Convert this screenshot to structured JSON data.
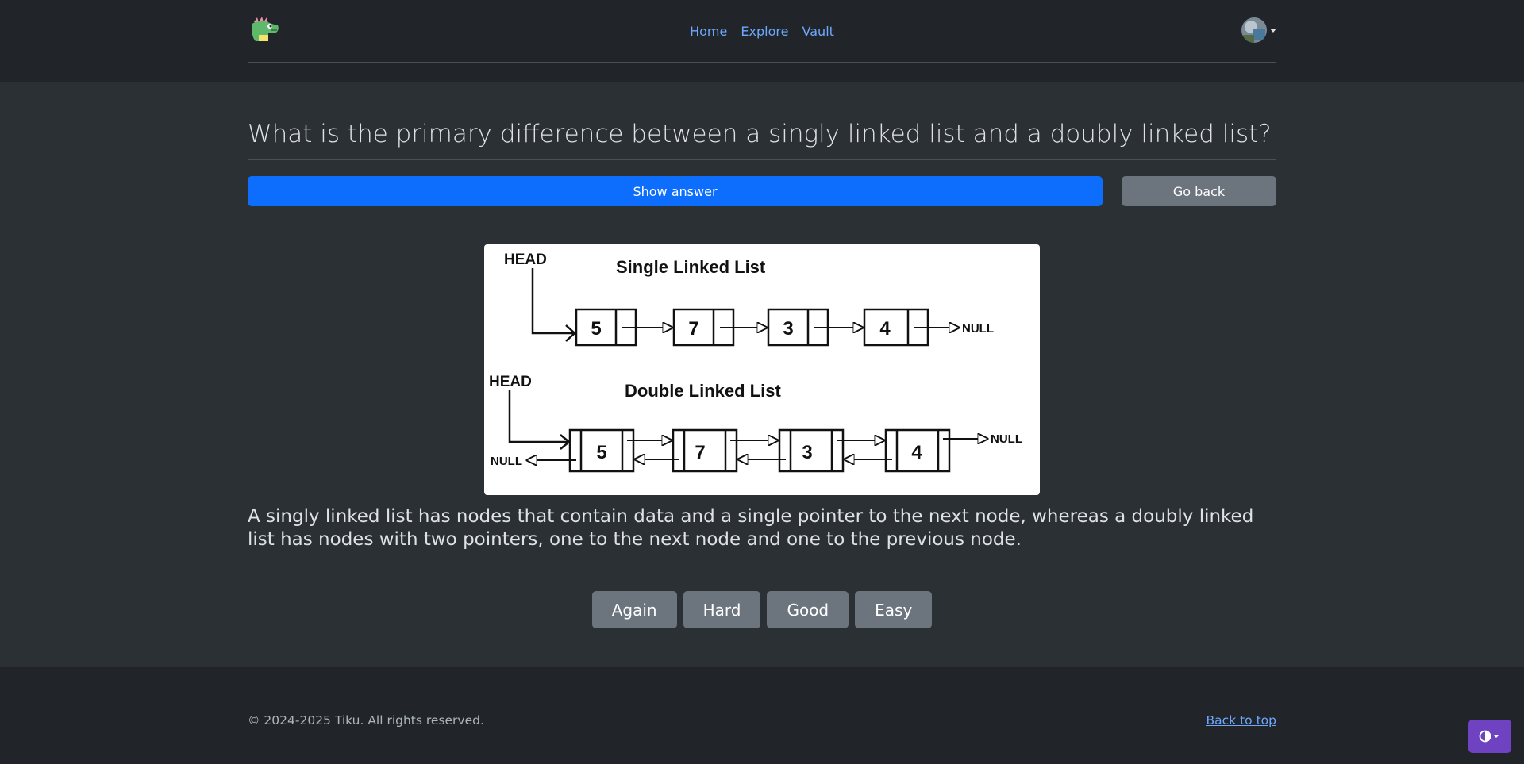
{
  "nav": {
    "items": [
      {
        "label": "Home"
      },
      {
        "label": "Explore"
      },
      {
        "label": "Vault"
      }
    ]
  },
  "card": {
    "question": "What is the primary difference between a singly linked list and a doubly linked list?",
    "show_answer_label": "Show answer",
    "go_back_label": "Go back",
    "answer": "A singly linked list has nodes that contain data and a single pointer to the next node, whereas a doubly linked list has nodes with two pointers, one to the next node and one to the previous node."
  },
  "diagram": {
    "single": {
      "title": "Single Linked List",
      "head_label": "HEAD",
      "values": [
        "5",
        "7",
        "3",
        "4"
      ],
      "null_label": "NULL"
    },
    "double": {
      "title": "Double Linked List",
      "head_label": "HEAD",
      "values": [
        "5",
        "7",
        "3",
        "4"
      ],
      "null_left_label": "NULL",
      "null_right_label": "NULL"
    }
  },
  "ratings": [
    {
      "label": "Again"
    },
    {
      "label": "Hard"
    },
    {
      "label": "Good"
    },
    {
      "label": "Easy"
    }
  ],
  "footer": {
    "copyright": "© 2024-2025 Tiku. All rights reserved.",
    "back_to_top": "Back to top"
  },
  "icons": {
    "logo": "dragon-logo-icon",
    "avatar": "user-avatar",
    "theme": "theme-toggle-icon"
  },
  "colors": {
    "primary": "#0d6efd",
    "secondary": "#6c757d",
    "theme_button": "#6f42c1",
    "link": "#6ea8fe"
  }
}
